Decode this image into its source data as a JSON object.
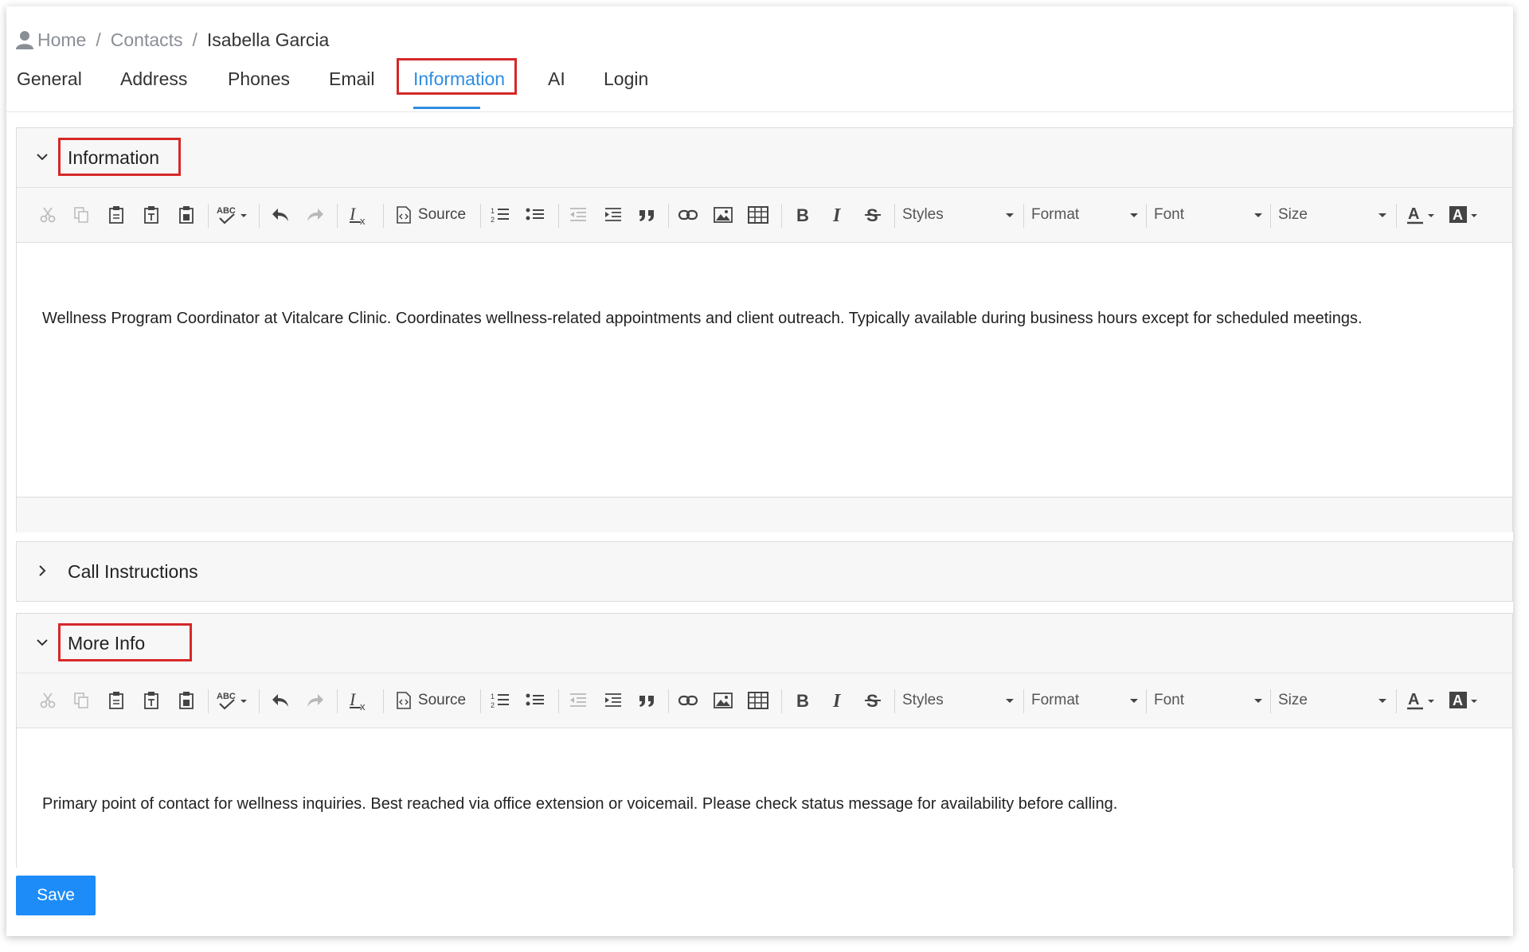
{
  "breadcrumb": {
    "home": "Home",
    "contacts": "Contacts",
    "current": "Isabella Garcia",
    "separator": "/"
  },
  "tabs": [
    {
      "label": "General"
    },
    {
      "label": "Address"
    },
    {
      "label": "Phones"
    },
    {
      "label": "Email"
    },
    {
      "label": "Information"
    },
    {
      "label": "AI"
    },
    {
      "label": "Login"
    }
  ],
  "active_tab": "Information",
  "toolbar": {
    "source_label": "Source",
    "styles_label": "Styles",
    "format_label": "Format",
    "font_label": "Font",
    "size_label": "Size"
  },
  "sections": {
    "information": {
      "title": "Information",
      "expanded": true,
      "body": "Wellness Program Coordinator at Vitalcare Clinic. Coordinates wellness-related appointments and client outreach. Typically available during business hours except for scheduled meetings."
    },
    "call_instructions": {
      "title": "Call Instructions",
      "expanded": false
    },
    "more_info": {
      "title": "More Info",
      "expanded": true,
      "body": "Primary point of contact for wellness inquiries. Best reached via office extension or voicemail. Please check status message for availability before calling."
    }
  },
  "save_button": "Save",
  "colors": {
    "accent": "#2e8de0",
    "save": "#1d8cf8",
    "highlight": "#d62828"
  }
}
